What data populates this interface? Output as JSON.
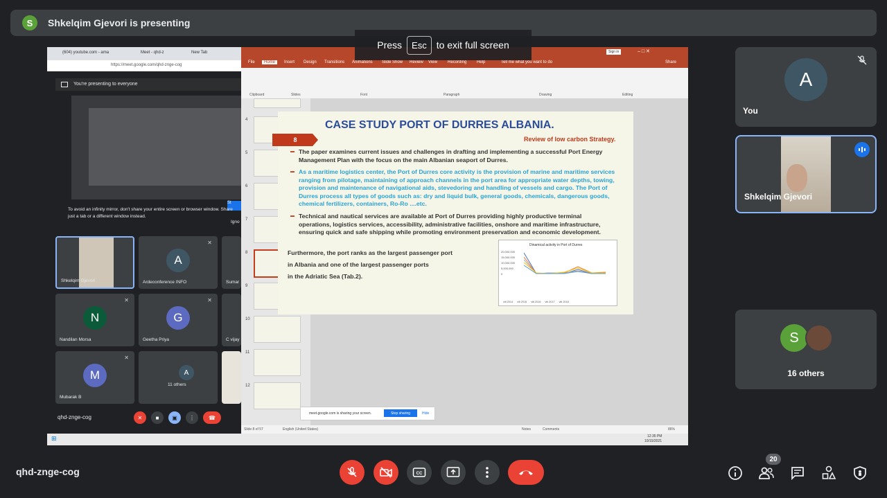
{
  "banner": {
    "avatar_letter": "S",
    "text": "Shkelqim Gjevori is presenting"
  },
  "esc_hint": {
    "pre": "Press",
    "key": "Esc",
    "post": "to exit full screen"
  },
  "shared_screen": {
    "browser": {
      "tabs": [
        "(604) youtube.com - ama",
        "Meet - qhd-z",
        "New Tab"
      ],
      "url": "https://meet.google.com/qhd-znge-cog",
      "presenting_text": "You're presenting to everyone",
      "warning": "To avoid an infinity mirror, don't share your entire screen or browser window. Share just a tab or a different window instead.",
      "ignore_label": "Igno",
      "share_label": "St",
      "tiles": [
        {
          "name": "Shkelqim Gjevori",
          "letter": "",
          "color": "#3c4043"
        },
        {
          "name": "Ardeconference INFO",
          "letter": "A",
          "color": "#3f5765"
        },
        {
          "name": "Sumar",
          "letter": "",
          "color": "#3c4043"
        },
        {
          "name": "Nandilan Morsa",
          "letter": "N",
          "color": "#0b5a3a"
        },
        {
          "name": "Geetha Priya",
          "letter": "G",
          "color": "#5c6bc0"
        },
        {
          "name": "C vijay",
          "letter": "",
          "color": "#3c4043"
        },
        {
          "name": "Mubarak B",
          "letter": "M",
          "color": "#5c6bc0"
        },
        {
          "name": "11 others",
          "letter": "A",
          "color": "#3f5765"
        }
      ],
      "meeting_code": "qhd-znge-cog"
    },
    "powerpoint": {
      "ribbon_tabs": [
        "File",
        "Home",
        "Insert",
        "Design",
        "Transitions",
        "Animations",
        "Slide Show",
        "Review",
        "View",
        "Recording",
        "Help",
        "Tell me what you want to do"
      ],
      "ribbon_groups": [
        "Clipboard",
        "Slides",
        "Font",
        "Paragraph",
        "Drawing",
        "Editing"
      ],
      "sign_in": "Sign in",
      "share": "Share",
      "thumb_numbers": [
        "4",
        "5",
        "6",
        "7",
        "8",
        "9",
        "10",
        "11",
        "12"
      ],
      "status_left": "Slide 8 of 57",
      "status_lang": "English (United States)",
      "status_notes": "Notes",
      "status_comments": "Comments",
      "zoom": "86%",
      "sharing_note": "meet.google.com is sharing your screen.",
      "stop_sharing": "Stop sharing",
      "hide": "Hide",
      "clock": "12:35 PM",
      "date": "10/15/2021"
    },
    "slide": {
      "title": "CASE STUDY PORT OF DURRES ALBANIA.",
      "badge": "8",
      "review": "Review of low carbon Strategy.",
      "para1": "The paper examines current issues and challenges in drafting and implementing a successful Port Energy Management Plan with the focus on the main Albanian seaport of Durres.",
      "para2": "As a maritime logistics center, the Port of Durres core activity is the provision of marine and maritime services ranging from pilotage, maintaining of approach channels in the port area for appropriate water depths, towing, provision and maintenance of navigational aids, stevedoring and handling of vessels and cargo. The Port of Durres process all types of goods such as: dry and liquid bulk, general goods, chemicals, dangerous goods, chemical fertilizers, containers, Ro-Ro ....etc.",
      "para3": "Technical and nautical services are available at Port of Durres providing highly productive terminal operations, logistics services, accessibility, administrative facilities, onshore and maritime infrastructure, ensuring quick and safe shipping while promoting environment preservation and economic development.",
      "line1": "Furthermore, the port ranks as the largest passenger port",
      "line2": "in Albania and one of the largest passenger ports",
      "line3": "in the Adriatic Sea (Tab.2).",
      "chart_title": "Dinamical activity in Port of Durres",
      "chart_yticks": [
        "20,000,000",
        "15,000,000",
        "10,000,000",
        "5,000,000",
        "0"
      ],
      "chart_legend": [
        "viti 2014",
        "viti 2015",
        "viti 2016",
        "viti 2017",
        "viti 2018"
      ]
    }
  },
  "side": {
    "you": {
      "letter": "A",
      "label": "You"
    },
    "presenter": {
      "label": "Shkelqim Gjevori"
    },
    "others": {
      "letter": "S",
      "label": "16 others"
    }
  },
  "bottom": {
    "meeting_code": "qhd-znge-cog",
    "participants_count": "20"
  },
  "icons": [
    "mic-off-icon",
    "camera-off-icon",
    "captions-icon",
    "present-icon",
    "more-icon",
    "hangup-icon",
    "info-icon",
    "people-icon",
    "chat-icon",
    "activities-icon",
    "host-controls-icon"
  ],
  "colors": {
    "hangup_red": "#ea4335",
    "active_blue": "#8ab4f8",
    "ppt_orange": "#b7472a",
    "slide_title": "#2b4c9b",
    "slide_accent": "#c0391b"
  }
}
